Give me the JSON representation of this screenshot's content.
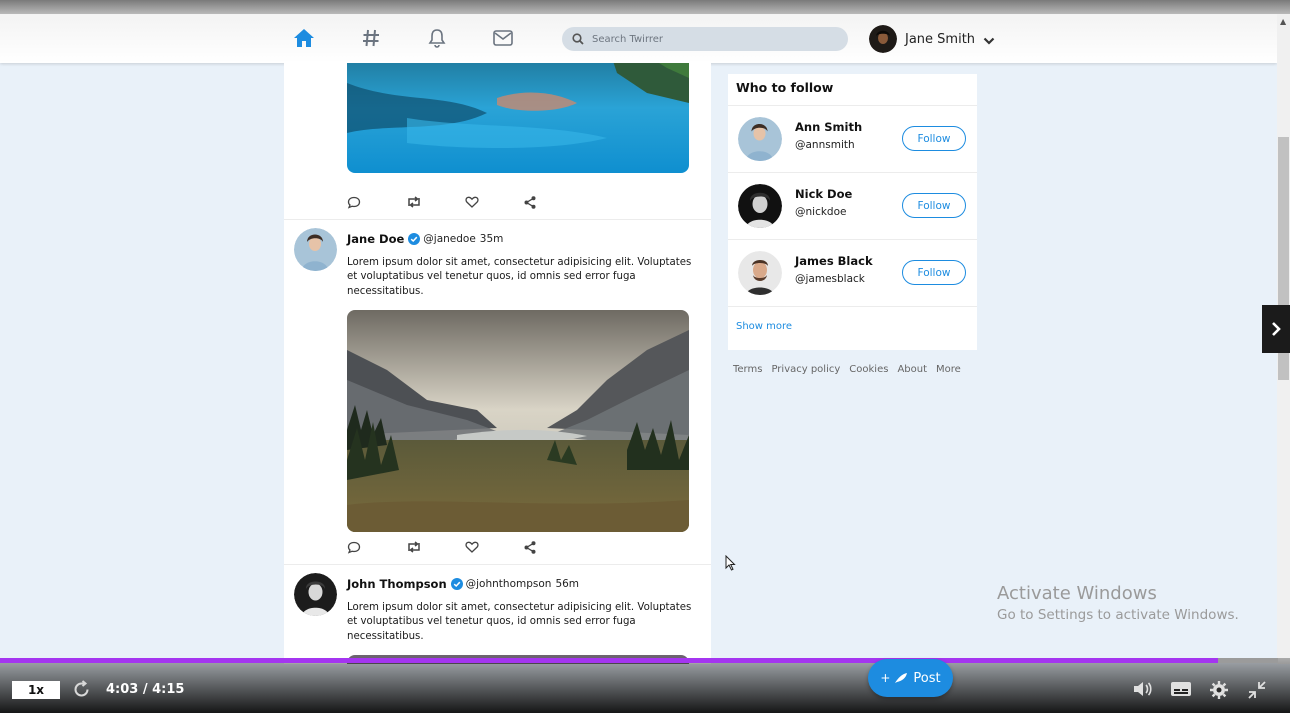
{
  "navbar": {
    "search_placeholder": "Search Twirrer",
    "user_name": "Jane Smith"
  },
  "feed": {
    "tweets": [
      {
        "name": "Jane Doe",
        "handle": "@janedoe",
        "time": "35m",
        "text": "Lorem ipsum dolor sit amet, consectetur adipisicing elit. Voluptates et voluptatibus vel tenetur quos, id omnis sed error fuga necessitatibus."
      },
      {
        "name": "John Thompson",
        "handle": "@johnthompson",
        "time": "56m",
        "text": "Lorem ipsum dolor sit amet, consectetur adipisicing elit. Voluptates et voluptatibus vel tenetur quos, id omnis sed error fuga necessitatibus."
      }
    ]
  },
  "who_to_follow": {
    "title": "Who to follow",
    "users": [
      {
        "name": "Ann Smith",
        "handle": "@annsmith",
        "button": "Follow"
      },
      {
        "name": "Nick Doe",
        "handle": "@nickdoe",
        "button": "Follow"
      },
      {
        "name": "James Black",
        "handle": "@jamesblack",
        "button": "Follow"
      }
    ],
    "show_more": "Show more"
  },
  "footer_links": [
    "Terms",
    "Privacy policy",
    "Cookies",
    "About",
    "More"
  ],
  "post_button": "Post",
  "watermark": {
    "title": "Activate Windows",
    "subtitle": "Go to Settings to activate Windows."
  },
  "player": {
    "speed": "1x",
    "time": "4:03 / 4:15",
    "progress": 0.953
  },
  "icons": {
    "home": "home-icon",
    "hashtag": "hashtag-icon",
    "bell": "bell-icon",
    "mail": "mail-icon",
    "search": "search-icon",
    "chevron": "chevron-down-icon",
    "verified": "verified-badge-icon",
    "reply": "comment-icon",
    "retweet": "retweet-icon",
    "like": "heart-icon",
    "share": "share-icon"
  },
  "colors": {
    "accent": "#1d8ce0",
    "progress": "#a435f0",
    "page_bg": "#e9f1f9"
  }
}
